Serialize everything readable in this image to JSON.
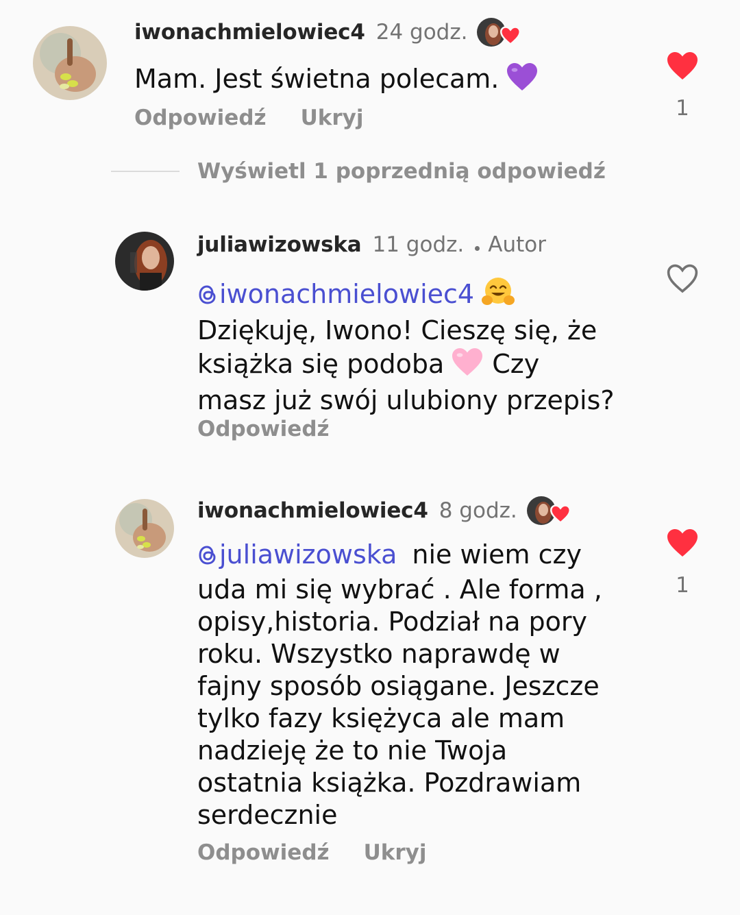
{
  "colors": {
    "background": "#fafafa",
    "username": "#262626",
    "meta_gray": "#737373",
    "action_gray": "#8e8e8e",
    "mention_blue": "#4a4fd1",
    "heart_red": "#ff3040"
  },
  "comments": [
    {
      "username": "iwonachmielowiec4",
      "time": "24 godz.",
      "author_badge": "",
      "liked_by_author": true,
      "mention": "",
      "lines": [
        "Mam. Jest świetna polecam."
      ],
      "emoji_icon": "purple-heart-icon",
      "actions": {
        "reply": "Odpowiedź",
        "hide": "Ukryj"
      },
      "liked": true,
      "like_count": "1"
    },
    {
      "username": "juliawizowska",
      "time": "11 godz.",
      "author_badge": "Autor",
      "liked_by_author": false,
      "mention": "iwonachmielowiec4",
      "lines": [
        "Dziękuję, Iwono! Cieszę się, że",
        "książka się podoba",
        "Czy",
        "masz już swój ulubiony przepis?"
      ],
      "actions": {
        "reply": "Odpowiedź"
      },
      "liked": false,
      "like_count": ""
    },
    {
      "username": "iwonachmielowiec4",
      "time": "8 godz.",
      "author_badge": "",
      "liked_by_author": true,
      "mention": "juliawizowska",
      "lines": [
        "nie wiem czy",
        "uda mi się wybrać . Ale forma ,",
        "opisy,historia. Podział na pory",
        "roku. Wszystko naprawdę w",
        "fajny sposób osiągane. Jeszcze",
        "tylko fazy księżyca ale mam",
        "nadzieję że to nie Twoja",
        "ostatnia książka. Pozdrawiam",
        "serdecznie"
      ],
      "actions": {
        "reply": "Odpowiedź",
        "hide": "Ukryj"
      },
      "liked": true,
      "like_count": "1"
    }
  ],
  "view_previous_replies": "Wyświetl 1 poprzednią odpowiedź"
}
